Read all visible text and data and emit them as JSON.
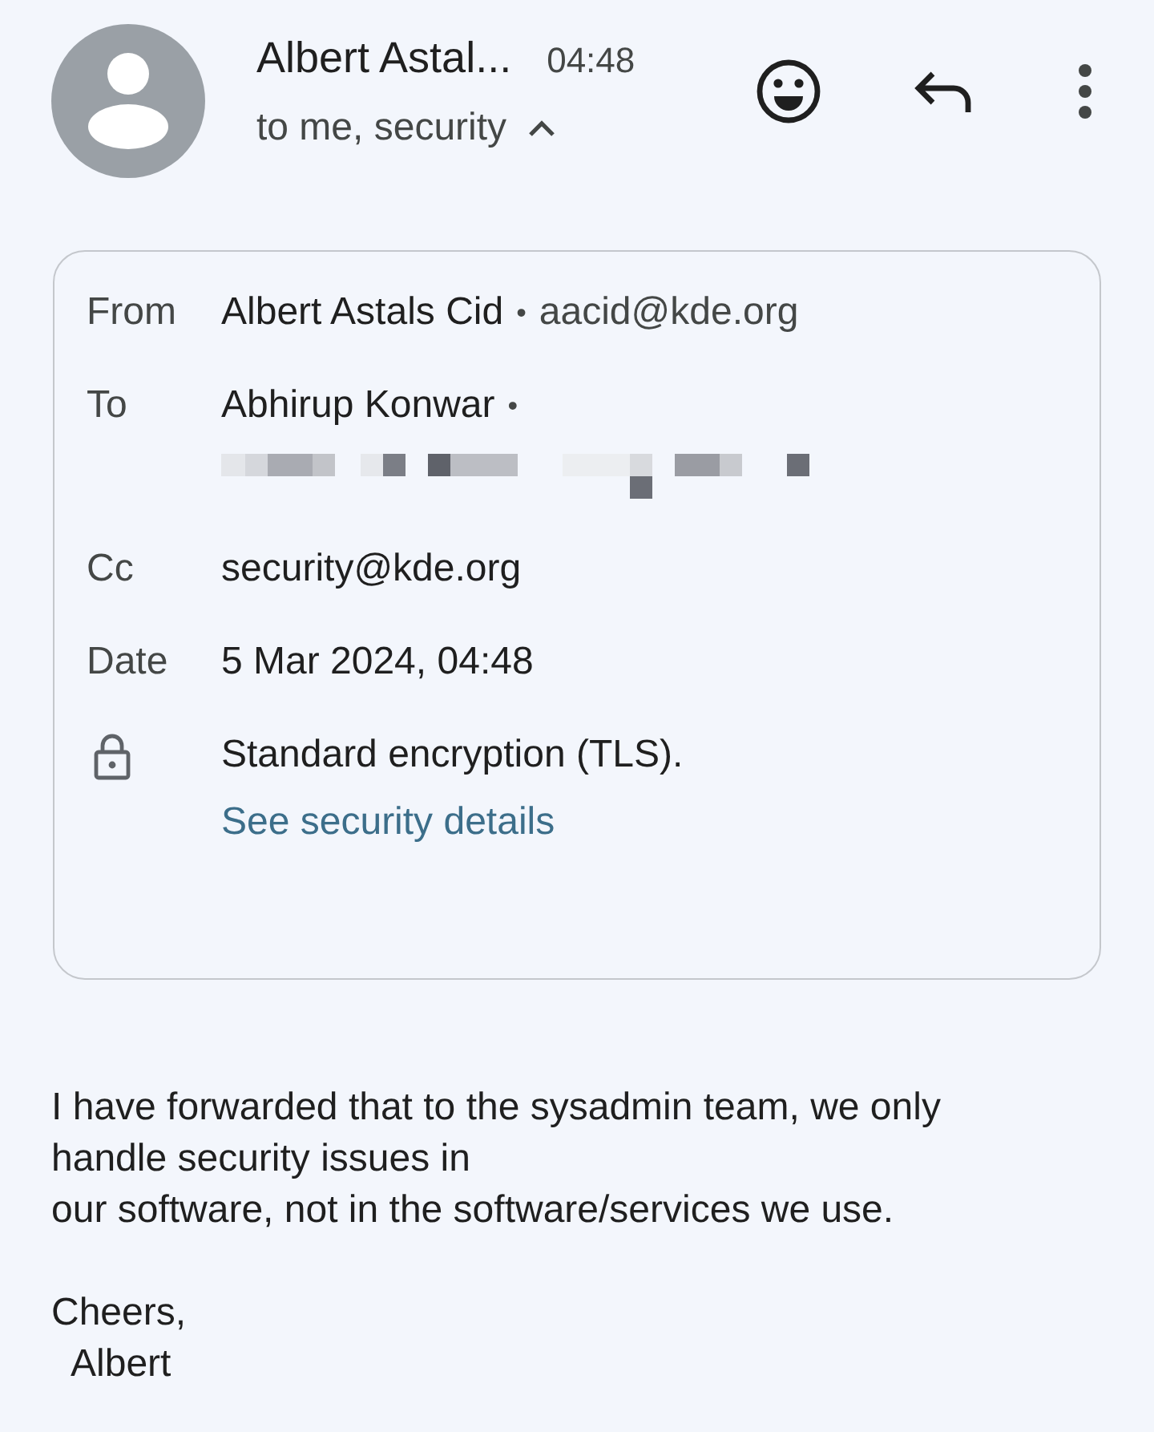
{
  "header": {
    "sender": "Albert Astal...",
    "time": "04:48",
    "recipients": "to me, security",
    "expanded": true
  },
  "details": [
    {
      "kind": "person",
      "label": "From",
      "name": "Albert Astals Cid",
      "separator": "•",
      "address": "aacid@kde.org"
    },
    {
      "kind": "redacted",
      "label": "To",
      "name": "Abhirup Konwar",
      "separator": "•"
    },
    {
      "kind": "plain",
      "label": "Cc",
      "value": "security@kde.org"
    },
    {
      "kind": "plain",
      "label": "Date",
      "value": "5 Mar 2024, 04:48"
    },
    {
      "kind": "security",
      "value": "Standard encryption (TLS).",
      "link": "See security details"
    }
  ],
  "body": {
    "lines": [
      "I have forwarded that to the sysadmin team, we only",
      "handle security issues in",
      "our software, not in the software/services we use."
    ],
    "signoff": [
      "Cheers,",
      "  Albert"
    ]
  }
}
